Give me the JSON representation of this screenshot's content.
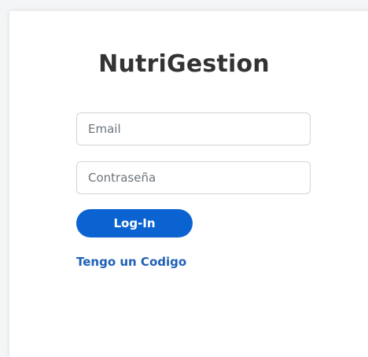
{
  "app": {
    "title": "NutriGestion"
  },
  "form": {
    "email_placeholder": "Email",
    "password_placeholder": "Contraseña",
    "login_label": "Log-In",
    "code_link_label": "Tengo un Codigo"
  },
  "colors": {
    "primary": "#0a63d1",
    "link": "#1e60b6",
    "title": "#333333"
  }
}
